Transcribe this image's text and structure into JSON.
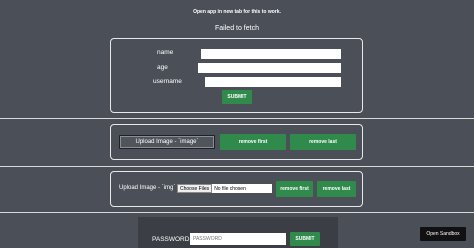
{
  "header": {
    "note": "Open app in new tab for this to work.",
    "fetch_status": "Failed to fetch"
  },
  "user_form": {
    "name_label": "name",
    "age_label": "age",
    "username_label": "username",
    "name_value": "",
    "age_value": "",
    "username_value": "",
    "submit_label": "SUBMIT"
  },
  "upload_section_1": {
    "upload_label": "Upload Image - `image`",
    "remove_first_label": "remove first",
    "remove_last_label": "remove last"
  },
  "upload_section_2": {
    "upload_label": "Upload Image - `img`",
    "choose_files_label": "Choose Files",
    "no_file_label": "No file chosen",
    "remove_first_label": "remove first",
    "remove_last_label": "remove last"
  },
  "password_form": {
    "label": "PASSWORD",
    "placeholder": "PASSWORD",
    "submit_label": "SUBMIT"
  },
  "sandbox": {
    "open_label": "Open Sandbox"
  },
  "colors": {
    "background": "#4b5058",
    "button_green": "#2f8a4c",
    "border": "#e8e8e8"
  }
}
